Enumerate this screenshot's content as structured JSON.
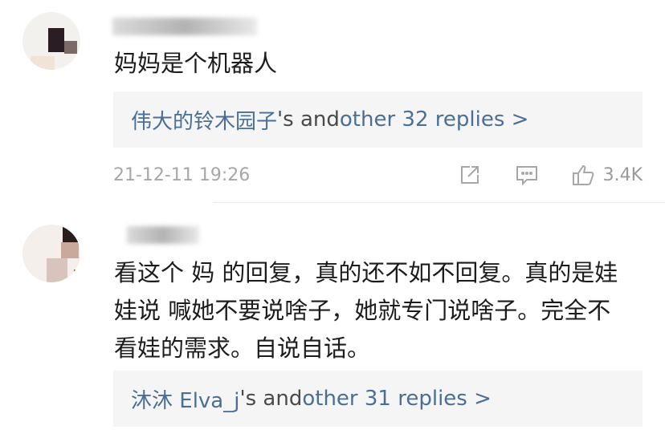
{
  "comments": [
    {
      "text": "妈妈是个机器人",
      "replies": {
        "name": "伟大的铃木园子",
        "mid": "'s and ",
        "other": "other 32 replies >"
      },
      "timestamp": "21-12-11 19:26",
      "likes": "3.4K"
    },
    {
      "text_lines": [
        "看这个 妈 的回复，真的还不如不回复。真的是娃",
        "娃说 喊她不要说啥子，她就专门说啥子。完全不",
        "看娃的需求。自说自话。"
      ],
      "replies": {
        "name": "沐沐 Elva_j",
        "mid": "'s and ",
        "other": "other 31 replies >"
      }
    }
  ],
  "icons": [
    "share-icon",
    "comment-icon",
    "like-icon"
  ]
}
